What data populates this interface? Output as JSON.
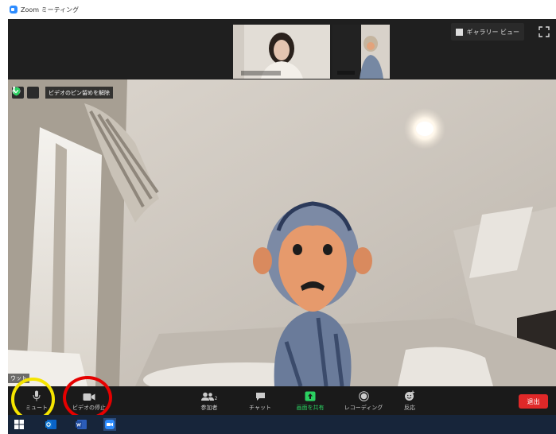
{
  "window": {
    "title": "Zoom ミーティング"
  },
  "header": {
    "gallery_view_label": "ギャラリー ビュー"
  },
  "video": {
    "unpin_label": "ビデオのピン留めを解除",
    "name_tag": "ウット"
  },
  "thumbnails": [
    {
      "name": ""
    },
    {
      "name": ""
    }
  ],
  "toolbar": {
    "mute_label": "ミュート",
    "stop_video_label": "ビデオの停止",
    "participants_label": "参加者",
    "participants_count": "2",
    "chat_label": "チャット",
    "share_label": "画面を共有",
    "record_label": "レコーディング",
    "reactions_label": "反応",
    "leave_label": "退出"
  },
  "colors": {
    "accent_share": "#2bd161",
    "leave": "#e02828",
    "highlight_yellow": "#f5e400",
    "highlight_red": "#e50000"
  }
}
